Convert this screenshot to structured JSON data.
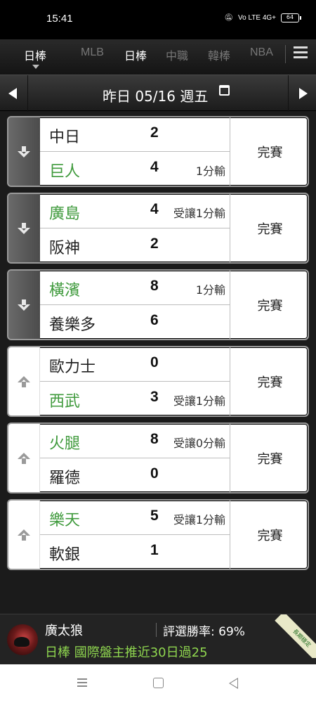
{
  "status_bar": {
    "time": "15:41",
    "signal_text": "Vo LTE 4G+",
    "battery": "64"
  },
  "tabs": {
    "items": [
      {
        "label": "日棒",
        "active": true
      },
      {
        "label": "MLB",
        "active": false
      },
      {
        "label": "日棒",
        "active": true
      },
      {
        "label": "中職",
        "active": false
      },
      {
        "label": "韓棒",
        "active": false
      },
      {
        "label": "NBA",
        "active": false
      }
    ],
    "menu_icon": "hamburger-icon"
  },
  "date_bar": {
    "label": "昨日 05/16 週五",
    "calendar_icon": "calendar-icon",
    "prev_icon": "triangle-left-icon",
    "next_icon": "triangle-right-icon"
  },
  "colors": {
    "green_team": "#3f9a3c",
    "promo_green": "#8fd64f",
    "card_side_dark": "#5a5a5a",
    "background": "#1b1b1b"
  },
  "games": [
    {
      "arrow": "down",
      "teams": [
        {
          "name": "中日",
          "score": "2",
          "note": "",
          "green": false
        },
        {
          "name": "巨人",
          "score": "4",
          "note": "1分輸",
          "green": true
        }
      ],
      "status": "完賽"
    },
    {
      "arrow": "down",
      "teams": [
        {
          "name": "廣島",
          "score": "4",
          "note": "受讓1分輸",
          "green": true
        },
        {
          "name": "阪神",
          "score": "2",
          "note": "",
          "green": false
        }
      ],
      "status": "完賽"
    },
    {
      "arrow": "down",
      "teams": [
        {
          "name": "橫濱",
          "score": "8",
          "note": "1分輸",
          "green": true
        },
        {
          "name": "養樂多",
          "score": "6",
          "note": "",
          "green": false
        }
      ],
      "status": "完賽"
    },
    {
      "arrow": "up",
      "teams": [
        {
          "name": "歐力士",
          "score": "0",
          "note": "",
          "green": false
        },
        {
          "name": "西武",
          "score": "3",
          "note": "受讓1分輸",
          "green": true
        }
      ],
      "status": "完賽"
    },
    {
      "arrow": "up",
      "teams": [
        {
          "name": "火腿",
          "score": "8",
          "note": "受讓0分輸",
          "green": true
        },
        {
          "name": "羅德",
          "score": "0",
          "note": "",
          "green": false
        }
      ],
      "status": "完賽"
    },
    {
      "arrow": "up",
      "teams": [
        {
          "name": "樂天",
          "score": "5",
          "note": "受讓1分輸",
          "green": true
        },
        {
          "name": "軟銀",
          "score": "1",
          "note": "",
          "green": false
        }
      ],
      "status": "完賽"
    }
  ],
  "promo": {
    "name": "廣太狼",
    "rate": "評選勝率: 69%",
    "line": "日棒 國際盤主推近30日過25",
    "badge": "長期穩定"
  },
  "nav": {
    "menu_icon": "recent-apps-icon",
    "home_icon": "home-icon",
    "back_icon": "back-icon"
  }
}
